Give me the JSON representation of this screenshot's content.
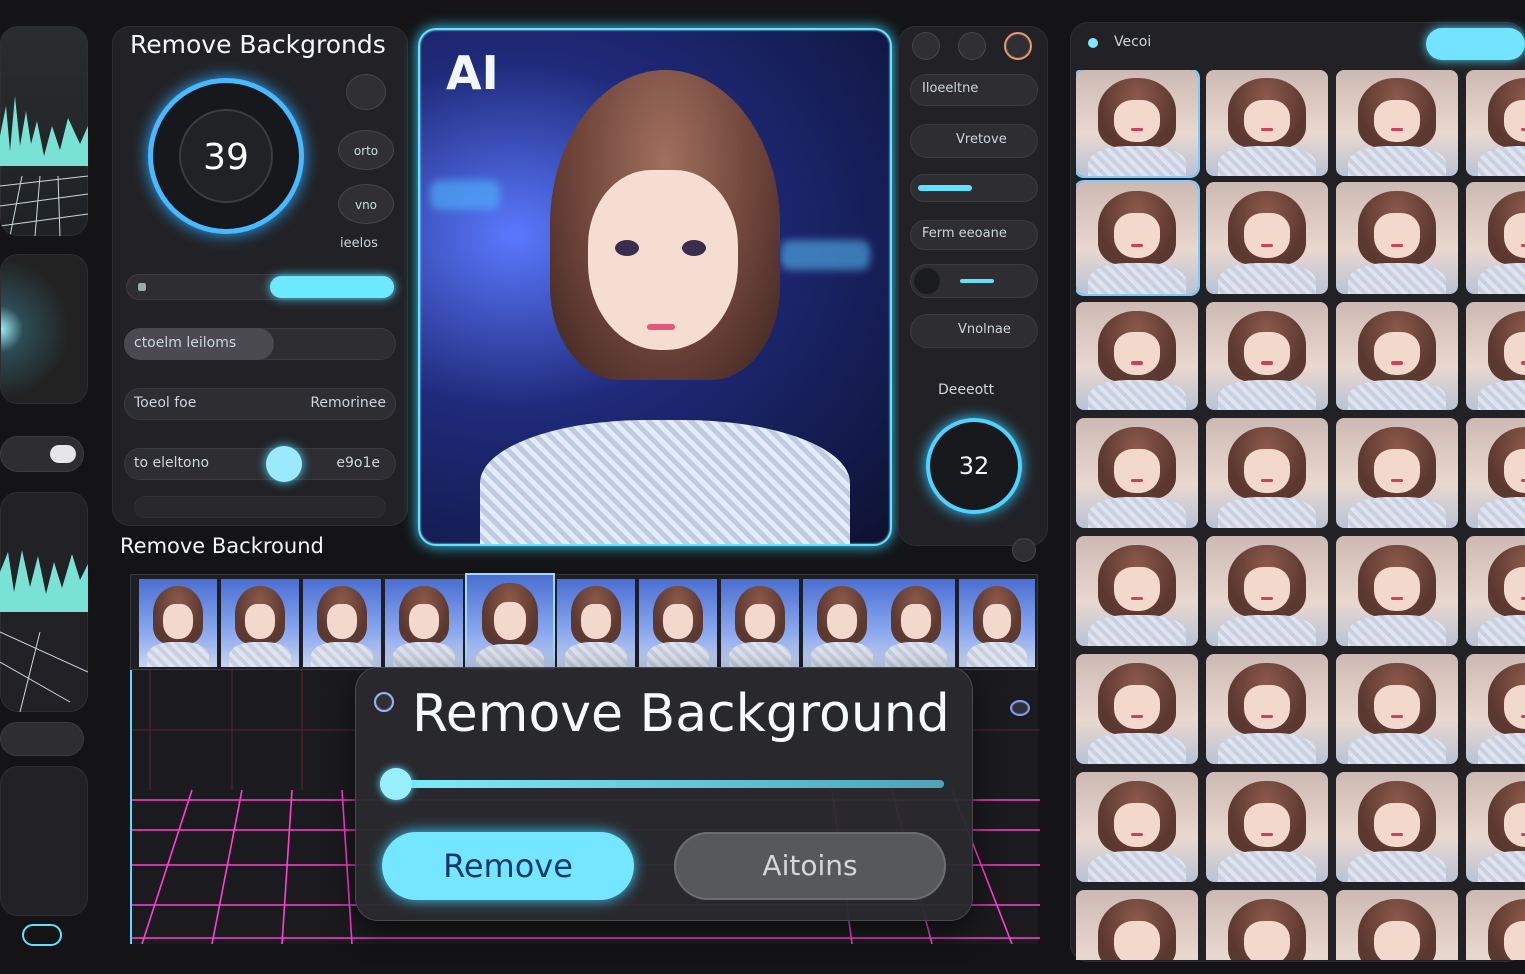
{
  "colors": {
    "accent": "#5fe1ff",
    "neon_pink": "#ff3fd0",
    "bg": "#141417"
  },
  "left_panel": {
    "title": "Remove Backgronds",
    "dial_value": "39",
    "btn1_label": "orto",
    "btn2_label": "vno",
    "small_label": "ieelos",
    "field_labels": [
      "ctoelm leiloms",
      "Toeol foe",
      "to eleltono"
    ],
    "field_values": [
      "Remorinee",
      "e9o1e"
    ]
  },
  "preview": {
    "badge": "AI"
  },
  "controls": {
    "items": [
      "Iloeeltne",
      "Vretove",
      "Ferm eeoane",
      "Vnolnae"
    ],
    "dial_caption": "Deeeott",
    "dial_value": "32"
  },
  "filmstrip": {
    "title": "Remove Backround",
    "frames": 11
  },
  "dialog": {
    "title": "Remove Background",
    "primary_label": "Remove",
    "secondary_label": "Aitoins"
  },
  "gallery": {
    "header_label": "Vecoi",
    "header_button": "",
    "rows": 8,
    "cols": 4
  }
}
